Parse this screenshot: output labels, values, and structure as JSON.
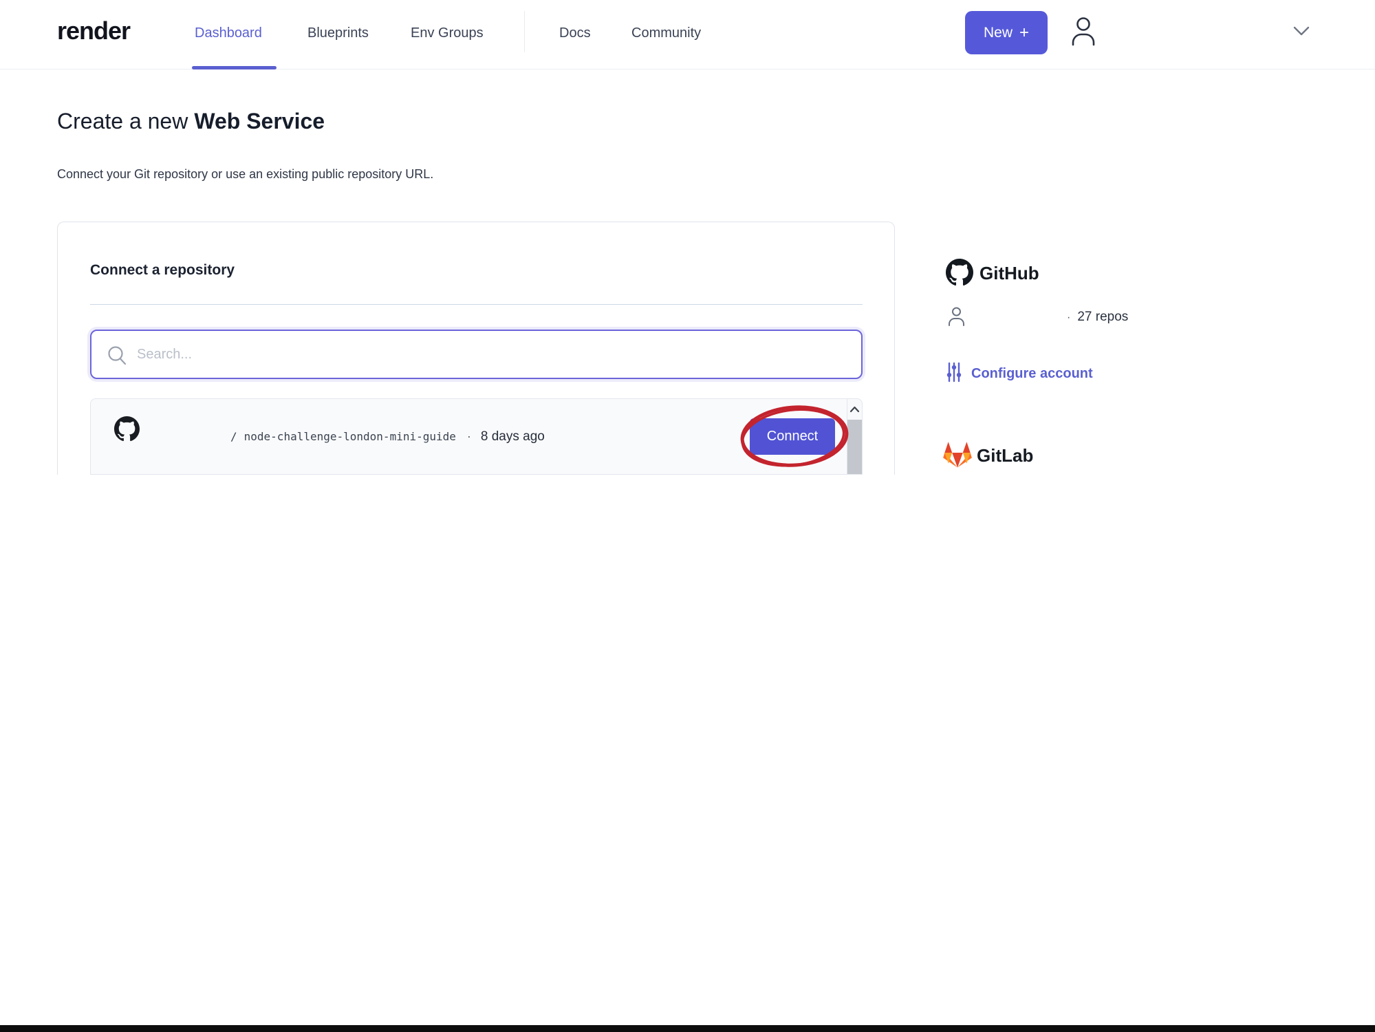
{
  "nav": {
    "logo": "render",
    "links": [
      {
        "label": "Dashboard"
      },
      {
        "label": "Blueprints"
      },
      {
        "label": "Env Groups"
      },
      {
        "label": "Docs"
      },
      {
        "label": "Community"
      }
    ],
    "new_button": {
      "label": "New",
      "plus": "+"
    }
  },
  "page": {
    "title_regular": "Create a new",
    "title_bold": "Web Service",
    "subtitle": "Connect your Git repository or use an existing public repository URL."
  },
  "card": {
    "header": "Connect a repository",
    "search_placeholder": "Search...",
    "repo": {
      "path_prefix": "/",
      "name": "node-challenge-london-mini-guide",
      "separator": "·",
      "updated": "8 days ago",
      "connect_label": "Connect"
    }
  },
  "sidebar": {
    "github": {
      "title": "GitHub",
      "repo_count_bullet": "·",
      "repo_count": "27 repos",
      "configure_label": "Configure account"
    },
    "gitlab": {
      "title": "GitLab"
    }
  },
  "colors": {
    "accent_purple": "#5559d9",
    "connect_purple": "#5153d4",
    "link_purple": "#5a5fd0",
    "annotation_red": "#c3242e",
    "gitlab_orange": "#e24329",
    "gitlab_light_orange": "#fc6d26"
  }
}
